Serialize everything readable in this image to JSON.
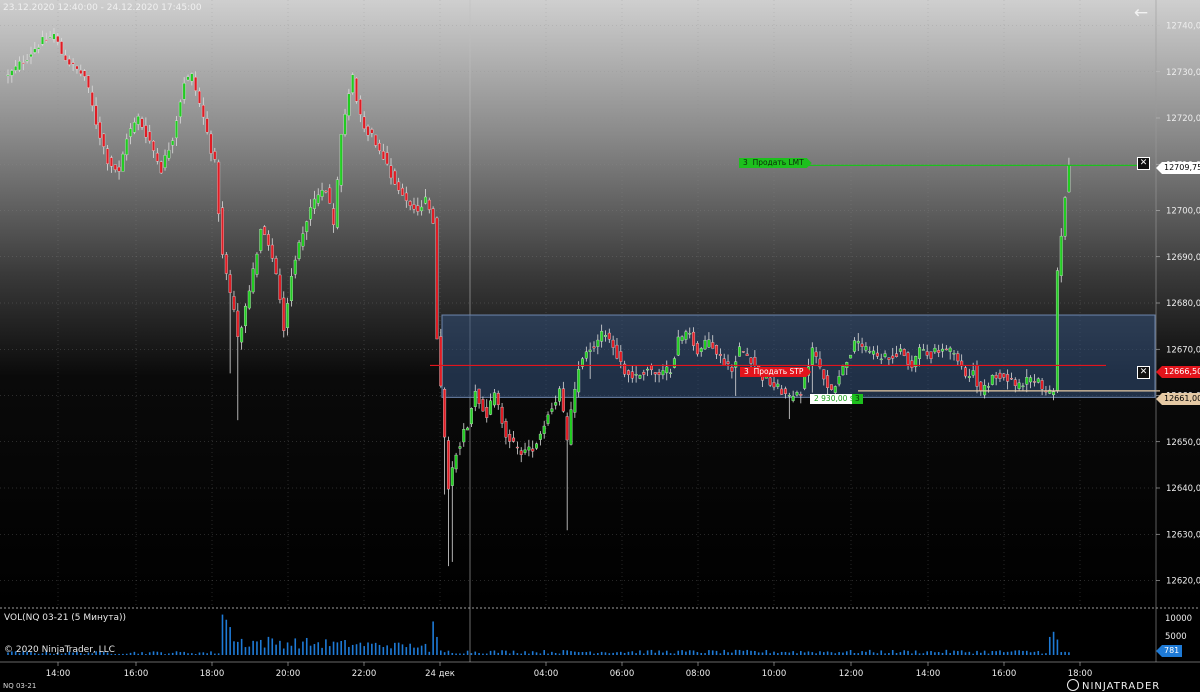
{
  "header": {
    "date_range": "23.12.2020 12:40:00 - 24.12.2020 17:45:00"
  },
  "price_axis": {
    "labels": [
      "12740,00",
      "12730,00",
      "12720,00",
      "12710,00",
      "12700,00",
      "12690,00",
      "12680,00",
      "12670,00",
      "12660,00",
      "12650,00",
      "12640,00",
      "12630,00",
      "12620,00"
    ],
    "min": 12616,
    "max": 12744
  },
  "time_axis": {
    "labels": [
      "14:00",
      "16:00",
      "18:00",
      "20:00",
      "22:00",
      "24 дек",
      "02:00",
      "04:00",
      "06:00",
      "08:00",
      "10:00",
      "12:00",
      "14:00",
      "16:00",
      "18:00"
    ]
  },
  "volume_panel": {
    "title": "VOL(NQ 03-21 (5 Минута))",
    "labels": [
      "10000",
      "5000"
    ],
    "current_value": "781",
    "color": "#1e7ad6"
  },
  "orders": {
    "limit": {
      "qty": "3",
      "label": "Продать LMT",
      "price": "12709,75",
      "color": "#1dc01d"
    },
    "stop": {
      "qty": "3",
      "label": "Продать STP",
      "price": "12666,50",
      "color": "#e3141c"
    }
  },
  "position": {
    "pnl": "2 930,00 $",
    "qty": "3",
    "avg_price": "12661,00"
  },
  "footer": {
    "copyright": "© 2020 NinjaTrader, LLC",
    "instrument_tab": "NQ 03-21",
    "brand": "NINJATRADER"
  },
  "colors": {
    "up": "#22cc22",
    "down": "#e01c24",
    "zone_fill": "#33507a",
    "zone_stroke": "#6d86ae"
  },
  "chart_data": {
    "type": "candlestick",
    "interval": "5 Минута",
    "instrument": "NQ 03-21",
    "y_range": [
      12616,
      12744
    ],
    "zone": {
      "top": 12677.4,
      "bottom": 12659.6
    },
    "path_anchors": [
      [
        0,
        12729
      ],
      [
        8,
        12736
      ],
      [
        12,
        12738
      ],
      [
        14,
        12734
      ],
      [
        17,
        12731
      ],
      [
        20,
        12729
      ],
      [
        23,
        12719
      ],
      [
        26,
        12711
      ],
      [
        29,
        12708
      ],
      [
        31,
        12716
      ],
      [
        34,
        12720
      ],
      [
        37,
        12715
      ],
      [
        40,
        12709
      ],
      [
        43,
        12716
      ],
      [
        46,
        12728
      ],
      [
        48,
        12729
      ],
      [
        51,
        12720
      ],
      [
        54,
        12710
      ],
      [
        56,
        12690
      ],
      [
        59,
        12678
      ],
      [
        60,
        12672
      ],
      [
        63,
        12682
      ],
      [
        66,
        12696
      ],
      [
        68,
        12693
      ],
      [
        70,
        12686
      ],
      [
        72,
        12675
      ],
      [
        74,
        12686
      ],
      [
        77,
        12696
      ],
      [
        80,
        12702
      ],
      [
        83,
        12705
      ],
      [
        85,
        12696
      ],
      [
        87,
        12716
      ],
      [
        89,
        12726
      ],
      [
        90,
        12729
      ],
      [
        92,
        12720
      ],
      [
        95,
        12716
      ],
      [
        98,
        12712
      ],
      [
        101,
        12706
      ],
      [
        104,
        12702
      ],
      [
        107,
        12700
      ],
      [
        109,
        12702
      ],
      [
        111,
        12698
      ],
      [
        112,
        12673
      ],
      [
        114,
        12650
      ],
      [
        115,
        12640
      ],
      [
        117,
        12648
      ],
      [
        120,
        12654
      ],
      [
        122,
        12661
      ],
      [
        125,
        12656
      ],
      [
        127,
        12660
      ],
      [
        130,
        12652
      ],
      [
        133,
        12648
      ],
      [
        136,
        12648
      ],
      [
        138,
        12650
      ],
      [
        141,
        12656
      ],
      [
        144,
        12661
      ],
      [
        146,
        12650
      ],
      [
        147,
        12656
      ],
      [
        149,
        12666
      ],
      [
        151,
        12669
      ],
      [
        154,
        12672
      ],
      [
        156,
        12674
      ],
      [
        159,
        12669
      ],
      [
        161,
        12665
      ],
      [
        164,
        12664
      ],
      [
        167,
        12666
      ],
      [
        170,
        12664
      ],
      [
        173,
        12666
      ],
      [
        175,
        12672
      ],
      [
        178,
        12674
      ],
      [
        180,
        12669
      ],
      [
        183,
        12672
      ],
      [
        186,
        12668
      ],
      [
        189,
        12666
      ],
      [
        191,
        12670
      ],
      [
        194,
        12668
      ],
      [
        197,
        12664
      ],
      [
        200,
        12662
      ],
      [
        202,
        12661
      ],
      [
        204,
        12659
      ],
      [
        207,
        12661
      ],
      [
        210,
        12670
      ],
      [
        213,
        12664
      ],
      [
        215,
        12661
      ],
      [
        218,
        12666
      ],
      [
        221,
        12671
      ],
      [
        224,
        12670
      ],
      [
        227,
        12668
      ],
      [
        230,
        12668
      ],
      [
        233,
        12670
      ],
      [
        236,
        12666
      ],
      [
        238,
        12670
      ],
      [
        241,
        12669
      ],
      [
        244,
        12670
      ],
      [
        247,
        12669
      ],
      [
        250,
        12664
      ],
      [
        252,
        12666
      ],
      [
        254,
        12660
      ],
      [
        257,
        12664
      ],
      [
        260,
        12665
      ],
      [
        263,
        12662
      ],
      [
        266,
        12663
      ],
      [
        269,
        12663
      ],
      [
        271,
        12660
      ],
      [
        273,
        12661
      ],
      [
        274,
        12686
      ],
      [
        276,
        12703
      ],
      [
        277,
        12709.75
      ]
    ],
    "volume_spikes": [
      [
        56,
        9400
      ],
      [
        57,
        8200
      ],
      [
        58,
        6500
      ],
      [
        111,
        7800
      ],
      [
        112,
        4200
      ],
      [
        272,
        4200
      ],
      [
        273,
        5400
      ],
      [
        274,
        3600
      ]
    ]
  }
}
